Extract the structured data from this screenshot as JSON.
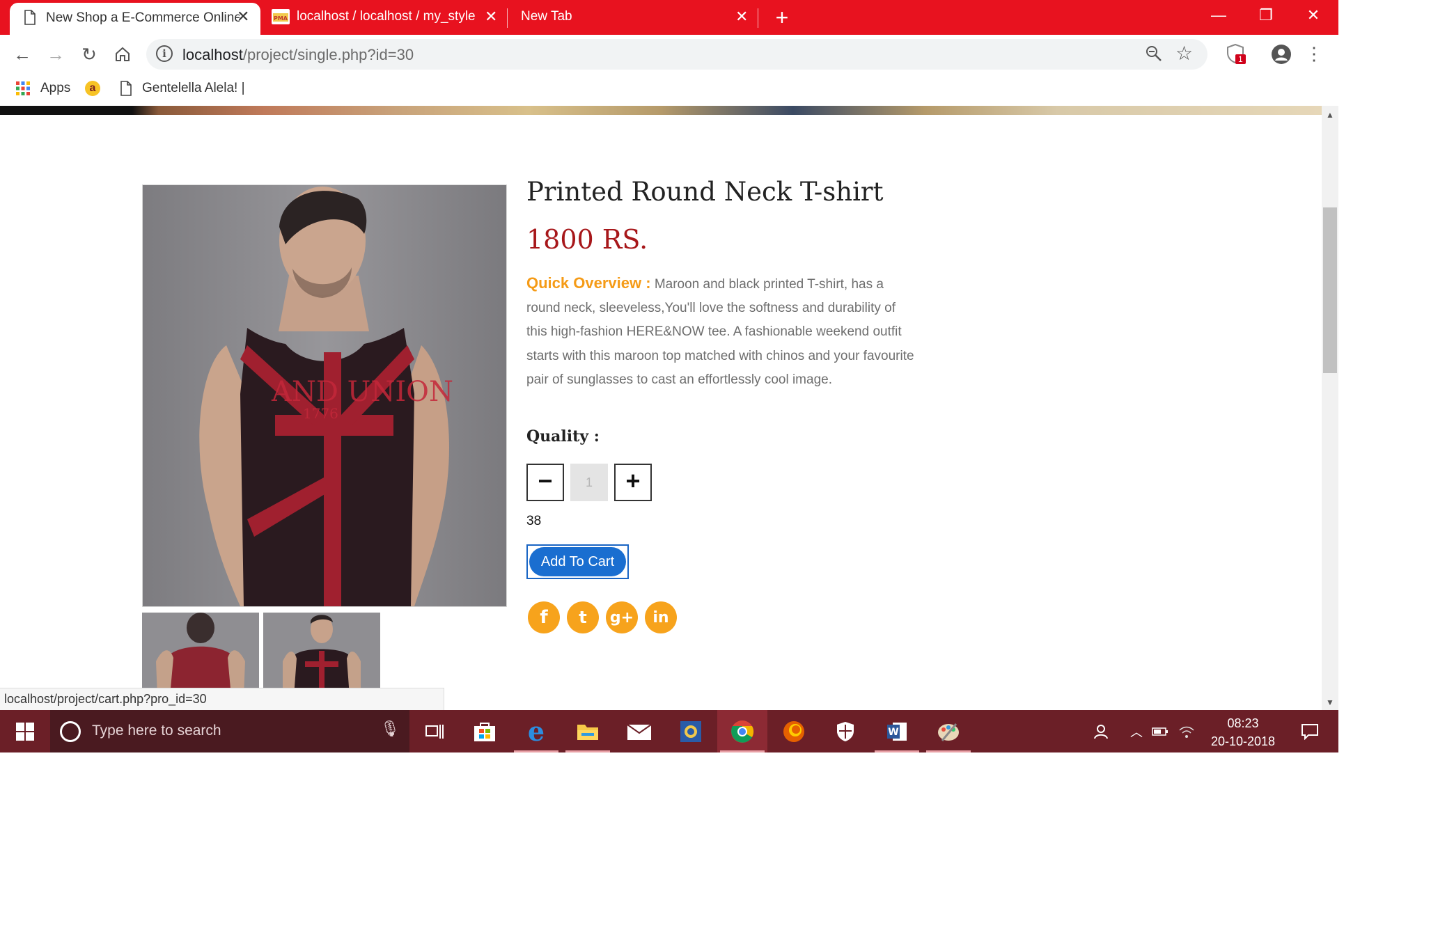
{
  "browser": {
    "tabs": [
      {
        "title": "New Shop a E-Commerce Online",
        "active": true
      },
      {
        "title": "localhost / localhost / my_style /",
        "active": false
      },
      {
        "title": "New Tab",
        "active": false
      }
    ],
    "new_tab_icon": "plus-icon",
    "url_host": "localhost",
    "url_path": "/project/single.php?id=30",
    "extension_badge": "1",
    "bookmarks": [
      {
        "label": "Apps",
        "icon": "apps-grid-icon"
      },
      {
        "label": "",
        "icon": "bookmark-logo-icon"
      },
      {
        "label": "Gentelella Alela! |",
        "icon": "page-icon"
      }
    ],
    "status_url": "localhost/project/cart.php?pro_id=30",
    "colors": {
      "tabstrip": "#e8121f",
      "omnibox": "#f1f3f4"
    }
  },
  "product": {
    "title": "Printed Round Neck T-shirt",
    "price": "1800 RS.",
    "overview_label": "Quick Overview :",
    "overview_text": "Maroon and black printed T-shirt, has a round neck, sleeveless,You'll love the softness and durability of this high-fashion HERE&NOW tee. A fashionable weekend outfit starts with this maroon top matched with chinos and your favourite pair of sunglasses to cast an effortlessly cool image.",
    "shirt_print": "AND UNION",
    "shirt_print_year": "1776",
    "quality_label": "Quality :",
    "quantity": "1",
    "decrement": "−",
    "increment": "+",
    "stock": "38",
    "add_to_cart": "Add To Cart",
    "social": [
      {
        "name": "facebook",
        "glyph": "f"
      },
      {
        "name": "twitter",
        "glyph": "t"
      },
      {
        "name": "google-plus",
        "glyph": "g+"
      },
      {
        "name": "linkedin",
        "glyph": "in"
      }
    ],
    "colors": {
      "price": "#a7171a",
      "overview_label": "#f59b17",
      "button": "#1a6ed0",
      "social": "#f7a31c"
    }
  },
  "taskbar": {
    "search_placeholder": "Type here to search",
    "apps": [
      "task-view",
      "store",
      "edge",
      "file-explorer",
      "mail",
      "photos",
      "chrome",
      "firefox",
      "security",
      "word",
      "paint"
    ],
    "time": "08:23",
    "date": "20-10-2018",
    "colors": {
      "bar": "#6b1f27",
      "search": "#4a1a20"
    }
  }
}
